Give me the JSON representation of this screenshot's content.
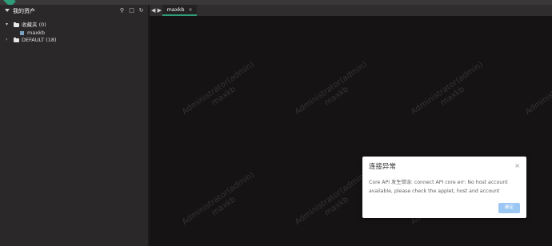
{
  "topbar": {
    "nav_items": [
      "",
      "",
      "",
      "",
      "",
      "",
      ""
    ]
  },
  "sidebar": {
    "title": "我的资产",
    "tools": {
      "search": "⚲",
      "collapse": "□",
      "refresh": "↻"
    },
    "tree": {
      "favorites_label": "收藏夹 (0)",
      "favorites_child": "maxkb",
      "default_label": "DEFAULT (18)"
    }
  },
  "tabs": {
    "nav": "◀ ▶",
    "active_label": "maxkb",
    "close_glyph": "×"
  },
  "watermark": {
    "line1": "Administrator(admin)",
    "line2": "maxkb"
  },
  "dialog": {
    "title": "连接异常",
    "close_glyph": "×",
    "message": "Core API 发生错误: connect API core err: No host account available, please check the applet, host and account",
    "ok_label": "确定"
  },
  "colors": {
    "accent": "#2f9c7a",
    "sidebar_bg": "#2a2828",
    "content_bg": "#151313",
    "button_primary": "#9cc7f3"
  }
}
